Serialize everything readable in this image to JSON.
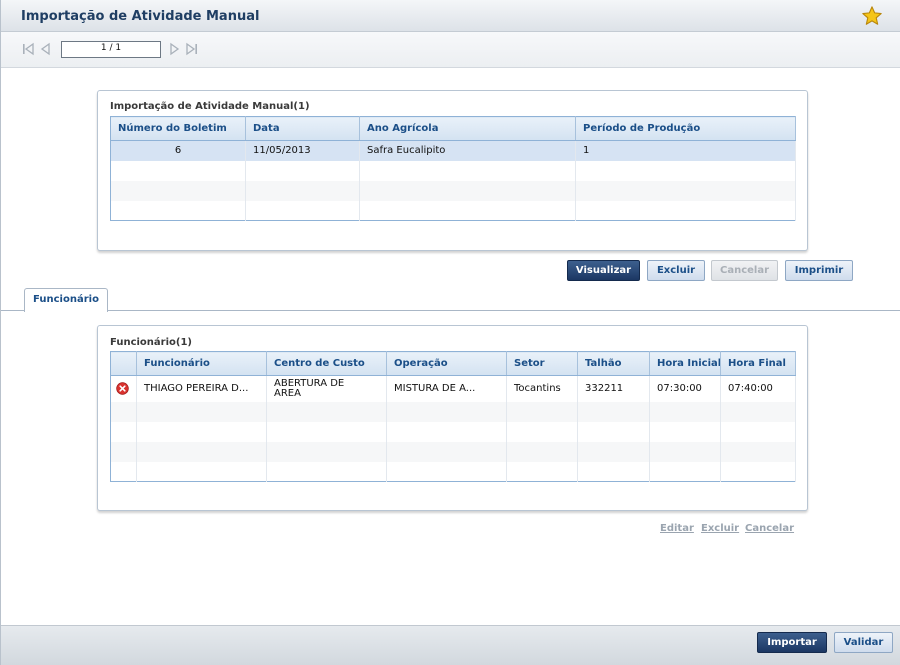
{
  "window": {
    "title": "Importação de Atividade Manual"
  },
  "nav": {
    "page_indicator": "1 / 1"
  },
  "boletim_panel": {
    "title": "Importação de Atividade Manual(1)",
    "columns": [
      "Número do Boletim",
      "Data",
      "Ano Agrícola",
      "Período de Produção"
    ],
    "rows": [
      {
        "numero": "6",
        "data": "11/05/2013",
        "ano": "Safra Eucalipito",
        "periodo": "1"
      }
    ]
  },
  "actions": {
    "visualizar": "Visualizar",
    "excluir": "Excluir",
    "cancelar": "Cancelar",
    "imprimir": "Imprimir"
  },
  "tabs": [
    {
      "label": "Funcionário",
      "active": true
    }
  ],
  "funcionario_panel": {
    "title": "Funcionário(1)",
    "columns": [
      "Funcionário",
      "Centro de Custo",
      "Operação",
      "Setor",
      "Talhão",
      "Hora Inicial",
      "Hora Final"
    ],
    "rows": [
      {
        "funcionario": "THIAGO PEREIRA D...",
        "centro_custo": "ABERTURA DE AREA",
        "operacao": "MISTURA DE A...",
        "setor": "Tocantins",
        "talhao": "332211",
        "hora_inicial": "07:30:00",
        "hora_final": "07:40:00"
      }
    ]
  },
  "row_actions": {
    "editar": "Editar",
    "excluir": "Excluir",
    "cancelar": "Cancelar"
  },
  "footer": {
    "importar": "Importar",
    "validar": "Validar"
  },
  "colors": {
    "accent": "#1b3763",
    "header_text": "#1b4f88",
    "selected_row": "#d6e3f3",
    "delete_icon": "#d9322f",
    "star": "#f5c518"
  },
  "icons": [
    "star-icon",
    "first-page-icon",
    "prev-page-icon",
    "next-page-icon",
    "last-page-icon",
    "delete-row-icon"
  ]
}
